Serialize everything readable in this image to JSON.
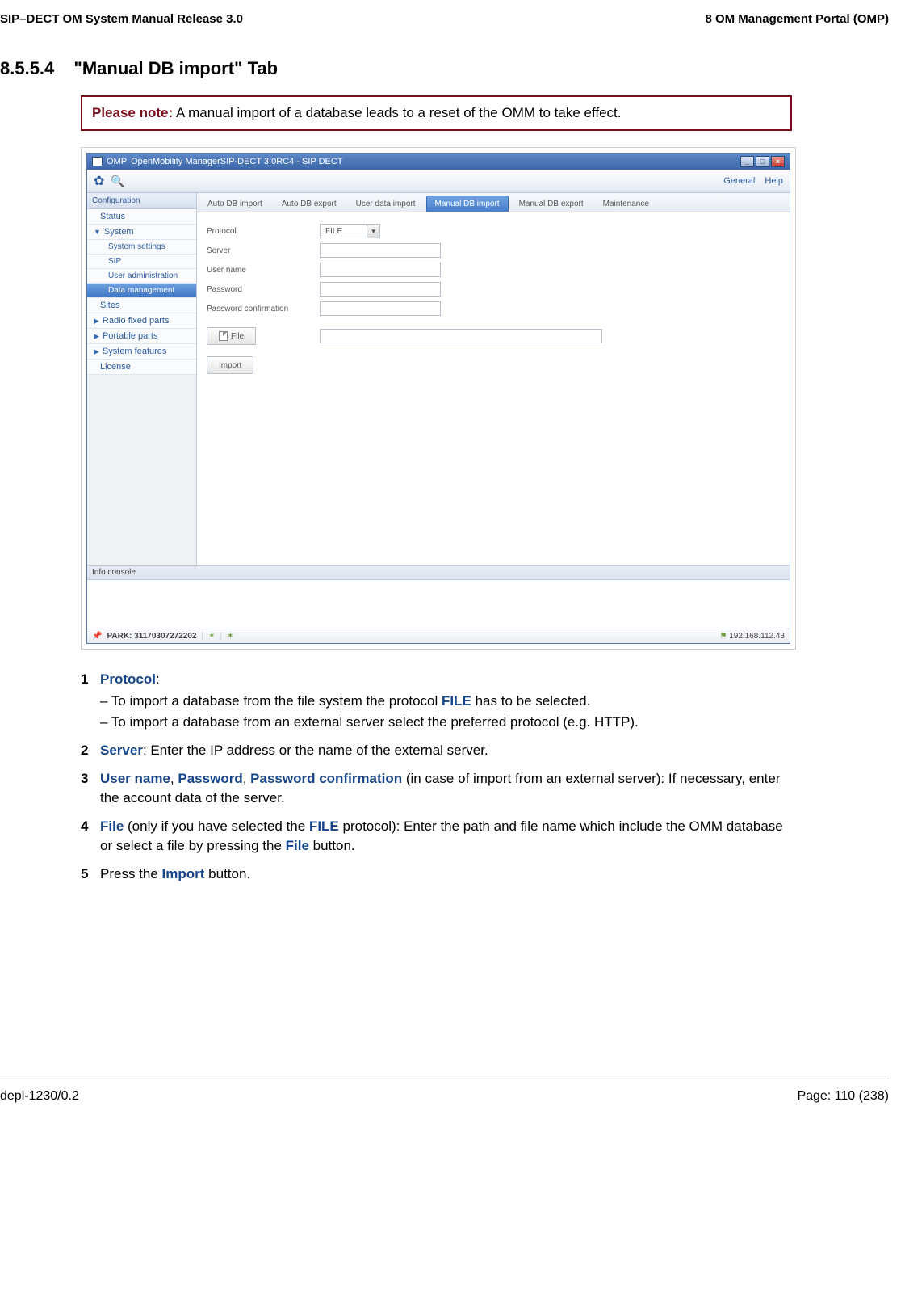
{
  "header": {
    "left": "SIP–DECT OM System Manual Release 3.0",
    "right": "8 OM Management Portal (OMP)"
  },
  "heading": {
    "number": "8.5.5.4",
    "title": "\"Manual DB import\" Tab"
  },
  "note": {
    "label": "Please note:",
    "text": "A manual import of a database leads to a reset of the OMM to take effect."
  },
  "app": {
    "title_prefix": "OMP",
    "title_main": "OpenMobility ManagerSIP-DECT 3.0RC4 - SIP DECT",
    "toolbar_right": {
      "general": "General",
      "help": "Help"
    },
    "sidebar": {
      "header": "Configuration",
      "items": {
        "status": "Status",
        "system": "System",
        "system_settings": "System settings",
        "sip": "SIP",
        "user_admin": "User administration",
        "data_mgmt": "Data management",
        "sites": "Sites",
        "radio": "Radio fixed parts",
        "portable": "Portable parts",
        "features": "System features",
        "license": "License"
      }
    },
    "tabs": {
      "auto_import": "Auto DB import",
      "auto_export": "Auto DB export",
      "user_data_import": "User data import",
      "manual_import": "Manual DB import",
      "manual_export": "Manual DB export",
      "maintenance": "Maintenance"
    },
    "form": {
      "protocol_label": "Protocol",
      "protocol_value": "FILE",
      "server_label": "Server",
      "username_label": "User name",
      "password_label": "Password",
      "password_conf_label": "Password confirmation",
      "file_btn": "File",
      "import_btn": "Import"
    },
    "info_console": "Info console",
    "status": {
      "park": "PARK: 31170307272202",
      "ip": "192.168.112.43"
    }
  },
  "steps": {
    "s1": {
      "kw": "Protocol",
      "line1a": "– To import a database from the file system the protocol ",
      "line1_kw": "FILE",
      "line1b": " has to be selected.",
      "line2": "– To import a database from an external server select the preferred protocol (e.g. HTTP)."
    },
    "s2": {
      "kw": "Server",
      "rest": ": Enter the IP address or the name of the external server."
    },
    "s3": {
      "kw1": "User name",
      "kw2": "Password",
      "kw3": "Password confirmation",
      "rest": " (in case of import from an external server): If necessary, enter the account data of the server."
    },
    "s4": {
      "kw1": "File",
      "mid1": " (only if you have selected the ",
      "kw2": "FILE",
      "mid2": " protocol): Enter the path and file name which include the OMM database or select a file by pressing the ",
      "kw3": "File",
      "end": " button."
    },
    "s5": {
      "pre": "Press the ",
      "kw": "Import",
      "post": " button."
    }
  },
  "footer": {
    "left": "depl-1230/0.2",
    "right": "Page: 110 (238)"
  }
}
